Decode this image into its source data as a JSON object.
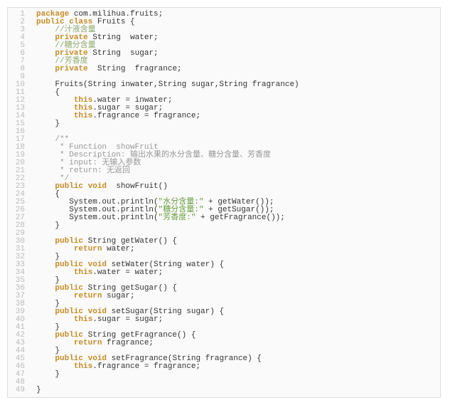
{
  "lines": [
    [
      [
        "kw",
        "package"
      ],
      [
        "txt",
        " com.milihua.fruits;"
      ]
    ],
    [
      [
        "kw",
        "public class"
      ],
      [
        "txt",
        " Fruits {"
      ]
    ],
    [
      [
        "txt",
        "    "
      ],
      [
        "cm",
        "//汁液含量"
      ]
    ],
    [
      [
        "txt",
        "    "
      ],
      [
        "kw",
        "private"
      ],
      [
        "txt",
        " String  water;"
      ]
    ],
    [
      [
        "txt",
        "    "
      ],
      [
        "cm",
        "//糖分含量"
      ]
    ],
    [
      [
        "txt",
        "    "
      ],
      [
        "kw",
        "private"
      ],
      [
        "txt",
        " String  sugar;"
      ]
    ],
    [
      [
        "txt",
        "    "
      ],
      [
        "cm",
        "//芳香度"
      ]
    ],
    [
      [
        "txt",
        "    "
      ],
      [
        "kw",
        "private"
      ],
      [
        "txt",
        "  String  fragrance;"
      ]
    ],
    [
      [
        "txt",
        ""
      ]
    ],
    [
      [
        "txt",
        "    Fruits(String inwater,String sugar,String fragrance)"
      ]
    ],
    [
      [
        "txt",
        "    {"
      ]
    ],
    [
      [
        "txt",
        "        "
      ],
      [
        "kw",
        "this"
      ],
      [
        "txt",
        ".water = inwater;"
      ]
    ],
    [
      [
        "txt",
        "        "
      ],
      [
        "kw",
        "this"
      ],
      [
        "txt",
        ".sugar = sugar;"
      ]
    ],
    [
      [
        "txt",
        "        "
      ],
      [
        "kw",
        "this"
      ],
      [
        "txt",
        ".fragrance = fragrance;"
      ]
    ],
    [
      [
        "txt",
        "    }"
      ]
    ],
    [
      [
        "txt",
        ""
      ]
    ],
    [
      [
        "txt",
        "    "
      ],
      [
        "doc",
        "/**"
      ]
    ],
    [
      [
        "txt",
        "     "
      ],
      [
        "doc",
        "* Function  showFruit"
      ]
    ],
    [
      [
        "txt",
        "     "
      ],
      [
        "doc",
        "* Description: 输出水果的水分含量、糖分含量、芳香度"
      ]
    ],
    [
      [
        "txt",
        "     "
      ],
      [
        "doc",
        "* input: 无输入参数"
      ]
    ],
    [
      [
        "txt",
        "     "
      ],
      [
        "doc",
        "* return: 无返回"
      ]
    ],
    [
      [
        "txt",
        "     "
      ],
      [
        "doc",
        "*/"
      ]
    ],
    [
      [
        "txt",
        "    "
      ],
      [
        "kw",
        "public void"
      ],
      [
        "txt",
        "  showFruit()"
      ]
    ],
    [
      [
        "txt",
        "    {"
      ]
    ],
    [
      [
        "txt",
        "       System.out.println("
      ],
      [
        "str",
        "\"水分含量:\""
      ],
      [
        "txt",
        " + getWater());"
      ]
    ],
    [
      [
        "txt",
        "       System.out.println("
      ],
      [
        "str",
        "\"糖分含量:\""
      ],
      [
        "txt",
        " + getSugar());"
      ]
    ],
    [
      [
        "txt",
        "       System.out.println("
      ],
      [
        "str",
        "\"芳香度:\""
      ],
      [
        "txt",
        " + getFragrance());"
      ]
    ],
    [
      [
        "txt",
        "    }"
      ]
    ],
    [
      [
        "txt",
        ""
      ]
    ],
    [
      [
        "txt",
        "    "
      ],
      [
        "kw",
        "public"
      ],
      [
        "txt",
        " String getWater() {"
      ]
    ],
    [
      [
        "txt",
        "        "
      ],
      [
        "kw",
        "return"
      ],
      [
        "txt",
        " water;"
      ]
    ],
    [
      [
        "txt",
        "    }"
      ]
    ],
    [
      [
        "txt",
        "    "
      ],
      [
        "kw",
        "public void"
      ],
      [
        "txt",
        " setWater(String water) {"
      ]
    ],
    [
      [
        "txt",
        "        "
      ],
      [
        "kw",
        "this"
      ],
      [
        "txt",
        ".water = water;"
      ]
    ],
    [
      [
        "txt",
        "    }"
      ]
    ],
    [
      [
        "txt",
        "    "
      ],
      [
        "kw",
        "public"
      ],
      [
        "txt",
        " String getSugar() {"
      ]
    ],
    [
      [
        "txt",
        "        "
      ],
      [
        "kw",
        "return"
      ],
      [
        "txt",
        " sugar;"
      ]
    ],
    [
      [
        "txt",
        "    }"
      ]
    ],
    [
      [
        "txt",
        "    "
      ],
      [
        "kw",
        "public void"
      ],
      [
        "txt",
        " setSugar(String sugar) {"
      ]
    ],
    [
      [
        "txt",
        "        "
      ],
      [
        "kw",
        "this"
      ],
      [
        "txt",
        ".sugar = sugar;"
      ]
    ],
    [
      [
        "txt",
        "    }"
      ]
    ],
    [
      [
        "txt",
        "    "
      ],
      [
        "kw",
        "public"
      ],
      [
        "txt",
        " String getFragrance() {"
      ]
    ],
    [
      [
        "txt",
        "        "
      ],
      [
        "kw",
        "return"
      ],
      [
        "txt",
        " fragrance;"
      ]
    ],
    [
      [
        "txt",
        "    }"
      ]
    ],
    [
      [
        "txt",
        "    "
      ],
      [
        "kw",
        "public void"
      ],
      [
        "txt",
        " setFragrance(String fragrance) {"
      ]
    ],
    [
      [
        "txt",
        "        "
      ],
      [
        "kw",
        "this"
      ],
      [
        "txt",
        ".fragrance = fragrance;"
      ]
    ],
    [
      [
        "txt",
        "    }"
      ]
    ],
    [
      [
        "txt",
        ""
      ]
    ],
    [
      [
        "txt",
        "}"
      ]
    ]
  ]
}
